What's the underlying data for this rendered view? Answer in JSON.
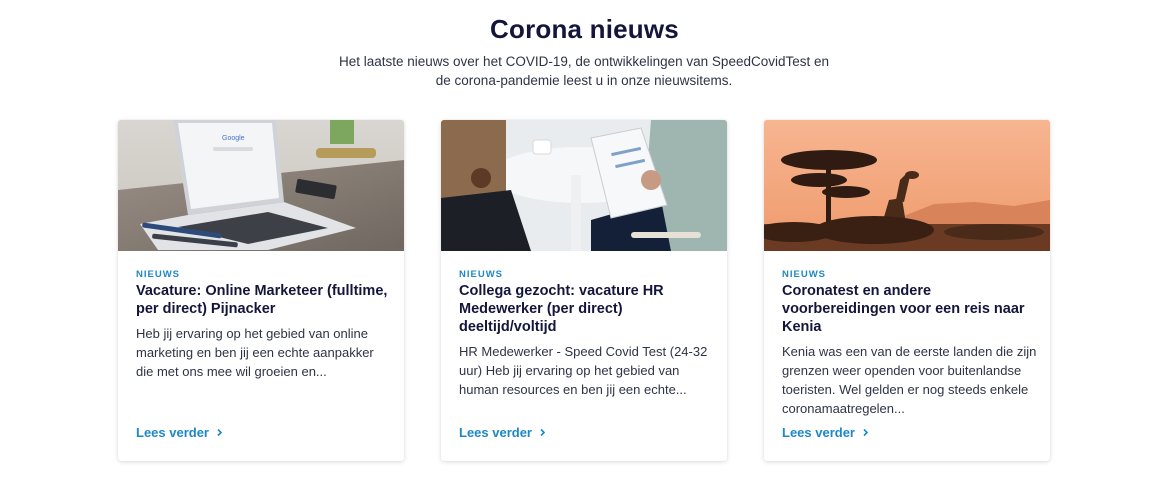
{
  "section": {
    "title": "Corona nieuws",
    "intro": "Het laatste nieuws over het COVID-19, de ontwikkelingen van SpeedCovidTest en de corona-pandemie leest u in onze nieuwsitems."
  },
  "cards": [
    {
      "category": "NIEUWS",
      "title": "Vacature: Online Marketeer (fulltime, per direct) Pijnacker",
      "excerpt": "Heb jij ervaring op het gebied van online marketing en ben jij een echte aanpakker die met ons mee wil groeien en...",
      "link_label": "Lees verder",
      "image_subject": "laptop with Google search on a desk"
    },
    {
      "category": "NIEUWS",
      "title": "Collega gezocht: vacature HR Medewerker (per direct) deeltijd/voltijd",
      "excerpt": "HR Medewerker - Speed Covid Test (24-32 uur) Heb jij ervaring op het gebied van human resources en ben jij een echte...",
      "link_label": "Lees verder",
      "image_subject": "interview with clipboard at a white table"
    },
    {
      "category": "NIEUWS",
      "title": "Coronatest en andere voorbereidingen voor een reis naar Kenia",
      "excerpt": "Kenia was een van de eerste landen die zijn grenzen weer openden voor buitenlandse toeristen. Wel gelden er nog steeds enkele coronamaatregelen...",
      "link_label": "Lees verder",
      "image_subject": "giraffe and acacia trees at sunset"
    }
  ],
  "logo_text": "Google",
  "colors": {
    "accent": "#1e88c7",
    "heading": "#13163a",
    "body_text": "#2f3347"
  }
}
